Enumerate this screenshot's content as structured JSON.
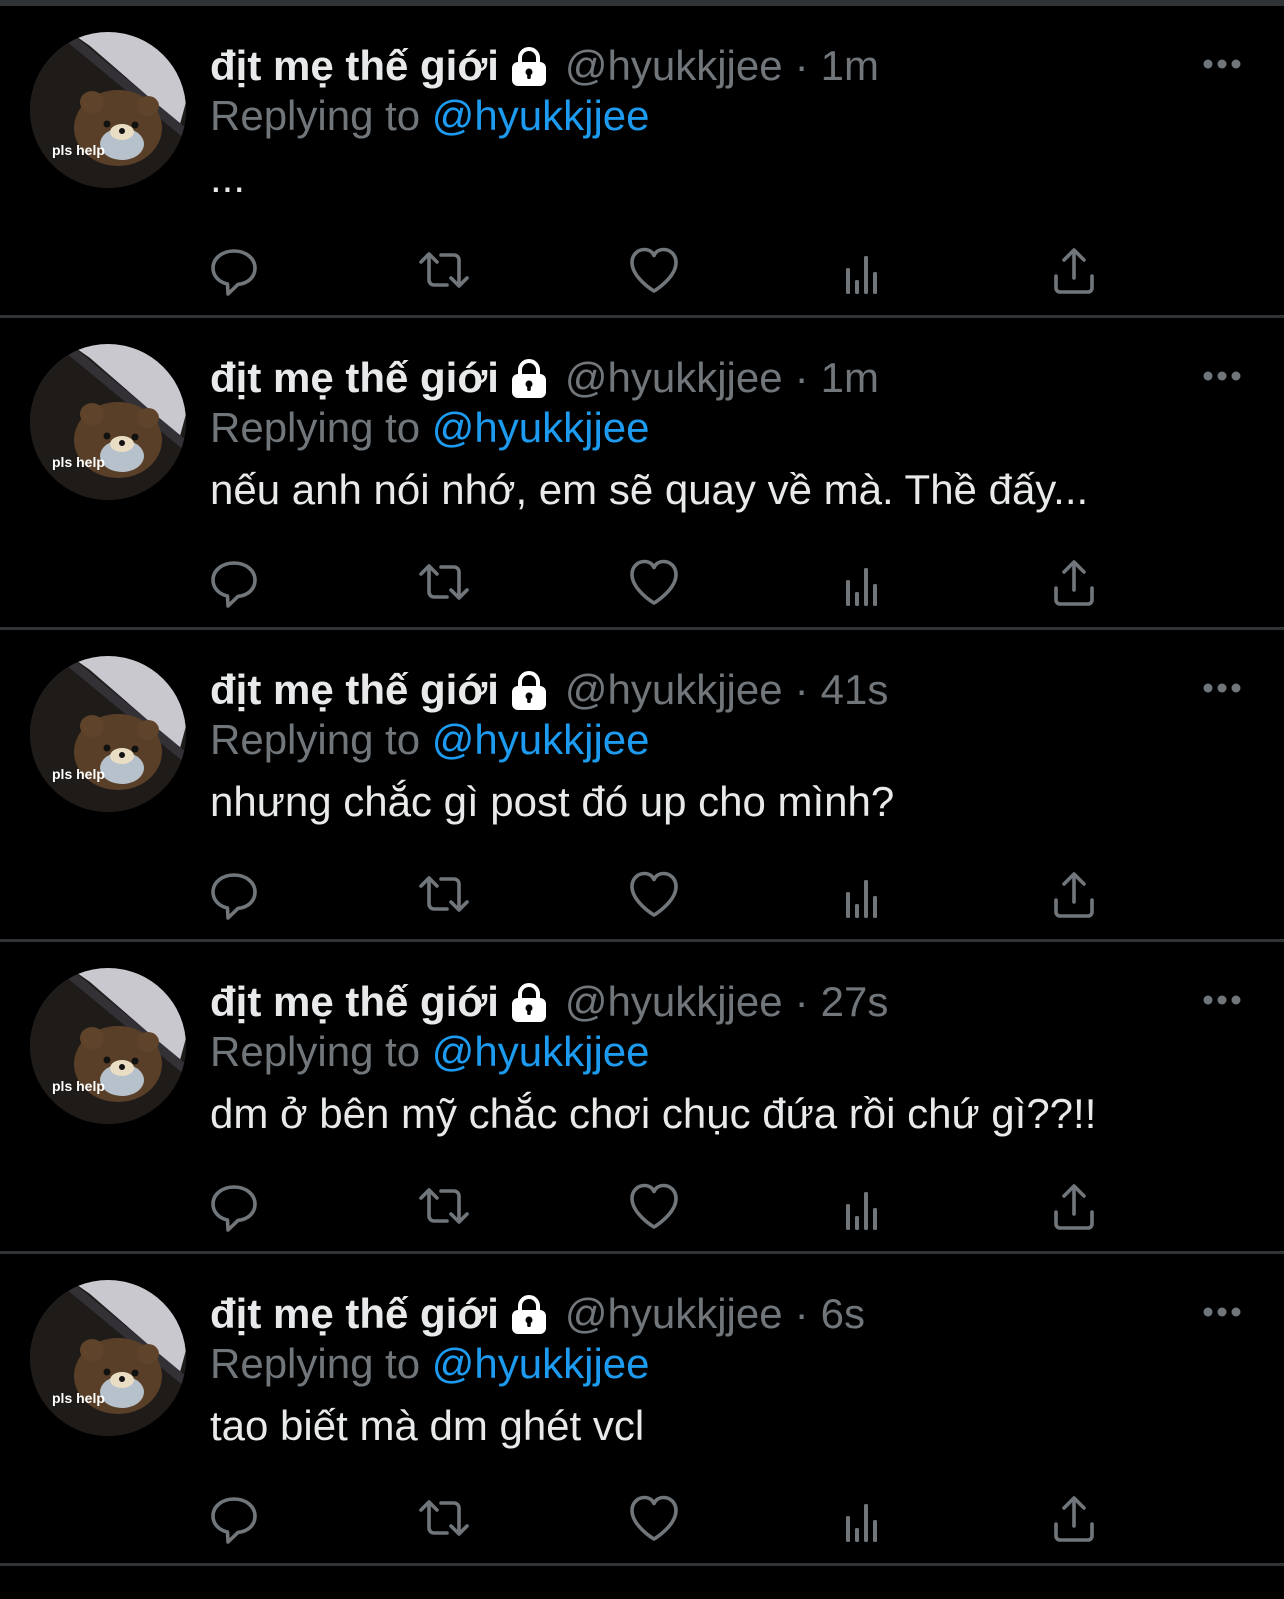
{
  "colors": {
    "background": "#000000",
    "text": "#e7e9ea",
    "muted": "#71767b",
    "accent": "#1d9bf0",
    "divider": "#2f3336"
  },
  "icons": {
    "lock": "lock-icon",
    "more": "more-icon",
    "reply": "reply-icon",
    "retweet": "retweet-icon",
    "like": "heart-icon",
    "analytics": "analytics-icon",
    "share": "share-icon"
  },
  "tweets": [
    {
      "avatar_caption": "pls help",
      "display_name": "địt mẹ thế giới",
      "handle": "@hyukkjjee",
      "separator": "·",
      "time": "1m",
      "replying_label": "Replying to",
      "replying_to": "@hyukkjjee",
      "text": "..."
    },
    {
      "avatar_caption": "pls help",
      "display_name": "địt mẹ thế giới",
      "handle": "@hyukkjjee",
      "separator": "·",
      "time": "1m",
      "replying_label": "Replying to",
      "replying_to": "@hyukkjjee",
      "text": "nếu anh nói nhớ, em sẽ quay về mà. Thề đấy..."
    },
    {
      "avatar_caption": "pls help",
      "display_name": "địt mẹ thế giới",
      "handle": "@hyukkjjee",
      "separator": "·",
      "time": "41s",
      "replying_label": "Replying to",
      "replying_to": "@hyukkjjee",
      "text": "nhưng chắc gì post đó up cho mình?"
    },
    {
      "avatar_caption": "pls help",
      "display_name": "địt mẹ thế giới",
      "handle": "@hyukkjjee",
      "separator": "·",
      "time": "27s",
      "replying_label": "Replying to",
      "replying_to": "@hyukkjjee",
      "text": "dm ở bên mỹ chắc chơi chục đứa rồi chứ gì??!!"
    },
    {
      "avatar_caption": "pls help",
      "display_name": "địt mẹ thế giới",
      "handle": "@hyukkjjee",
      "separator": "·",
      "time": "6s",
      "replying_label": "Replying to",
      "replying_to": "@hyukkjjee",
      "text": "tao biết mà dm ghét vcl"
    }
  ]
}
